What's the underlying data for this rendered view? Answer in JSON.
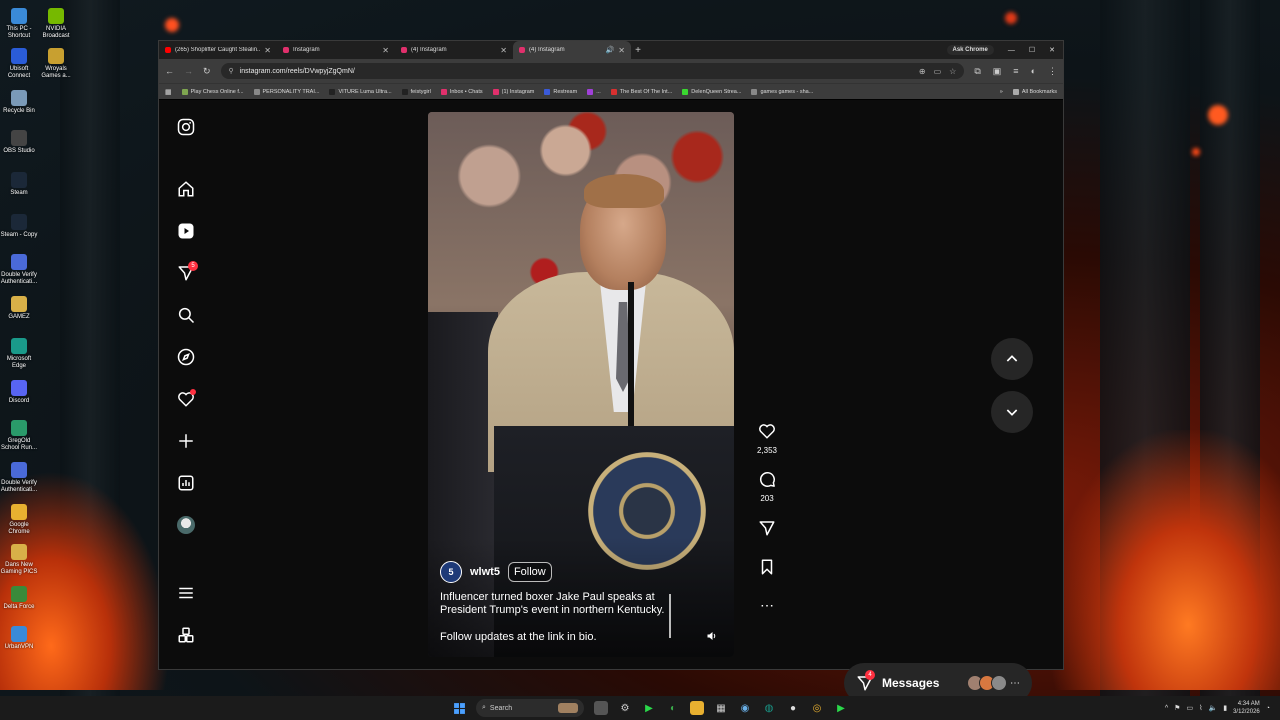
{
  "desktop": {
    "icons": [
      {
        "label": "This PC - Shortcut",
        "color": "#3a8ad8"
      },
      {
        "label": "NVIDIA Broadcast",
        "color": "#76b900"
      },
      {
        "label": "Ubisoft Connect",
        "color": "#2a5cd8"
      },
      {
        "label": "Wroyals Games a...",
        "color": "#c8a030"
      },
      {
        "label": "Recycle Bin",
        "color": "#7a9ab8"
      },
      {
        "label": "OBS Studio",
        "color": "#444"
      },
      {
        "label": "Steam",
        "color": "#1b2838"
      },
      {
        "label": "Steam - Copy",
        "color": "#1b2838"
      },
      {
        "label": "Double Verify Authenticati...",
        "color": "#4a6ad8"
      },
      {
        "label": "GAMEZ",
        "color": "#d8b048"
      },
      {
        "label": "Microsoft Edge",
        "color": "#1a9a8a"
      },
      {
        "label": "Discord",
        "color": "#5865f2"
      },
      {
        "label": "GregOld School Run...",
        "color": "#2a9a6a"
      },
      {
        "label": "Double Verify Authenticati...",
        "color": "#4a6ad8"
      },
      {
        "label": "Google Chrome",
        "color": "#e8b030"
      },
      {
        "label": "Dans New Gaming PICS",
        "color": "#d8b048"
      },
      {
        "label": "Delta Force",
        "color": "#3a8a3a"
      },
      {
        "label": "UrbanVPN",
        "color": "#3a8ad8"
      }
    ]
  },
  "browser": {
    "tabs": [
      {
        "label": "(265) Shoplifter Caught Stealin...",
        "favicon_color": "#ff0000",
        "active": false
      },
      {
        "label": "Instagram",
        "favicon_color": "#e1306c",
        "active": false
      },
      {
        "label": "(4) Instagram",
        "favicon_color": "#e1306c",
        "active": false
      },
      {
        "label": "(4) Instagram",
        "favicon_color": "#e1306c",
        "active": true
      }
    ],
    "ask_chrome": "Ask Chrome",
    "url": "instagram.com/reels/DVwpyjZgQmN/",
    "bookmarks": [
      {
        "label": "Play Chess Online f...",
        "color": "#7fa650"
      },
      {
        "label": "PERSONALITY TRAI...",
        "color": "#888"
      },
      {
        "label": "VITURE Luma Ultra...",
        "color": "#222"
      },
      {
        "label": "feistygirl",
        "color": "#222"
      },
      {
        "label": "Inbox • Chats",
        "color": "#e1306c"
      },
      {
        "label": "(1) Instagram",
        "color": "#e1306c"
      },
      {
        "label": "Restream",
        "color": "#3a5ad8"
      },
      {
        "label": "...",
        "color": "#a040d8"
      },
      {
        "label": "The Best Of The Int...",
        "color": "#d83030"
      },
      {
        "label": "DelenQueen Strea...",
        "color": "#3ad830"
      },
      {
        "label": "games games - sha...",
        "color": "#888"
      }
    ],
    "all_bookmarks": "All Bookmarks"
  },
  "instagram": {
    "sidebar": [
      {
        "name": "instagram-logo-icon",
        "glyph": "◎"
      },
      {
        "name": "home-icon",
        "glyph": "⌂"
      },
      {
        "name": "reels-icon",
        "glyph": "▶"
      },
      {
        "name": "messages-icon",
        "glyph": "▽",
        "badge": "5"
      },
      {
        "name": "search-icon",
        "glyph": "⌕"
      },
      {
        "name": "explore-icon",
        "glyph": "◈"
      },
      {
        "name": "notifications-icon",
        "glyph": "♡"
      },
      {
        "name": "create-icon",
        "glyph": "+"
      },
      {
        "name": "dashboard-icon",
        "glyph": "▥"
      },
      {
        "name": "profile-avatar",
        "glyph": "●"
      },
      {
        "name": "menu-icon",
        "glyph": "☰"
      },
      {
        "name": "also-from-meta-icon",
        "glyph": "⊞"
      }
    ],
    "reel": {
      "username": "wlwt5",
      "avatar_text": "5",
      "follow_label": "Follow",
      "caption": "Influencer turned boxer Jake Paul speaks at President Trump's event in northern Kentucky.",
      "caption_line2": "Follow updates at the link in bio."
    },
    "actions": {
      "likes": "2,353",
      "comments": "203"
    },
    "messages": {
      "label": "Messages",
      "badge": "4"
    }
  },
  "taskbar": {
    "search_label": "Search",
    "time": "4:34 AM",
    "date": "3/12/2026"
  }
}
